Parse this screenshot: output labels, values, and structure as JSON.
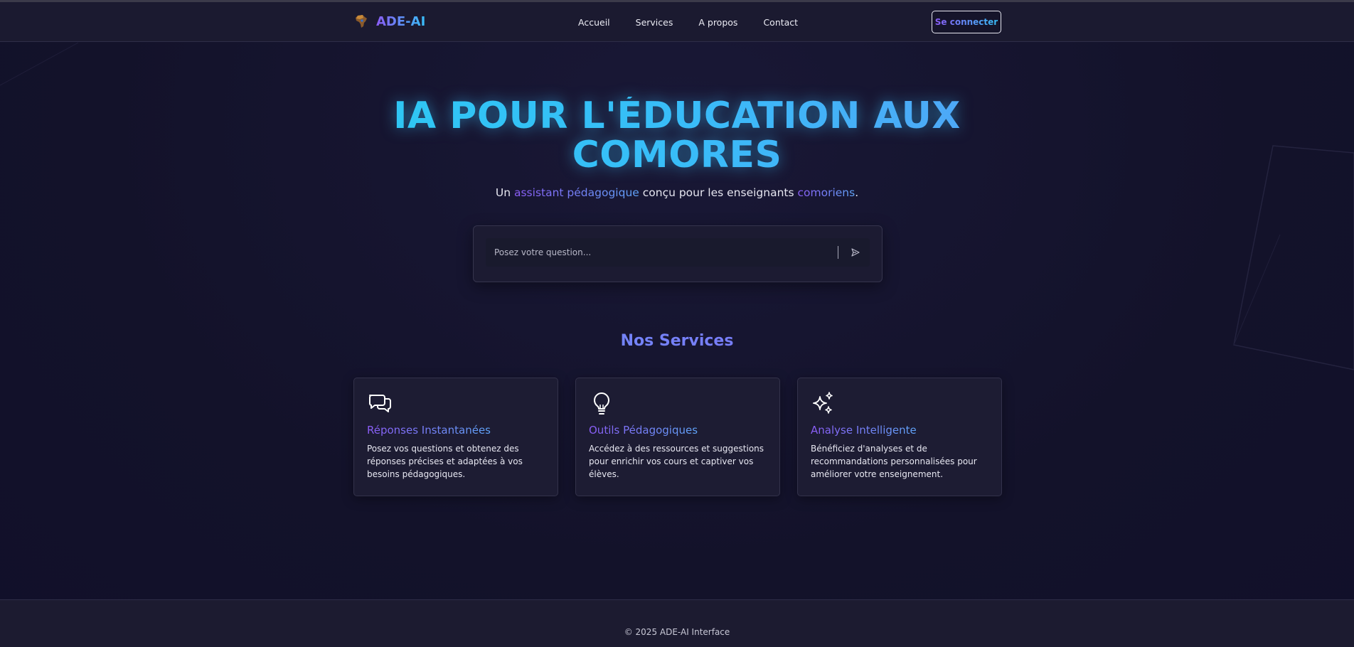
{
  "brand": {
    "name": "ADE-AI",
    "logo_icon": "africa-map-icon"
  },
  "nav": {
    "items": [
      {
        "label": "Accueil"
      },
      {
        "label": "Services"
      },
      {
        "label": "A propos"
      },
      {
        "label": "Contact"
      }
    ],
    "login_label": "Se connecter"
  },
  "hero": {
    "title_line1": "IA POUR L'ÉDUCATION AUX",
    "title_line2": "COMORES",
    "subtitle": {
      "part1": "Un ",
      "highlight1": "assistant pédagogique",
      "part2": " conçu pour les enseignants ",
      "highlight2": "comoriens",
      "part3": "."
    }
  },
  "question": {
    "placeholder": "Posez votre question...",
    "value": "",
    "send_icon": "send-icon"
  },
  "services": {
    "title": "Nos Services",
    "cards": [
      {
        "icon": "chat-bubbles-icon",
        "title": "Réponses Instantanées",
        "description": "Posez vos questions et obtenez des réponses précises et adaptées à vos besoins pédagogiques."
      },
      {
        "icon": "lightbulb-icon",
        "title": "Outils Pédagogiques",
        "description": "Accédez à des ressources et suggestions pour enrichir vos cours et captiver vos élèves."
      },
      {
        "icon": "sparkles-icon",
        "title": "Analyse Intelligente",
        "description": "Bénéficiez d'analyses et de recommandations personnalisées pour améliorer votre enseignement."
      }
    ]
  },
  "footer": {
    "copyright": "© 2025 ADE-AI Interface"
  },
  "colors": {
    "background": "#13122a",
    "header": "#1b1a30",
    "accent_purple": "#8b5cf6",
    "accent_cyan": "#22d3ee",
    "accent_blue": "#60a5fa"
  }
}
